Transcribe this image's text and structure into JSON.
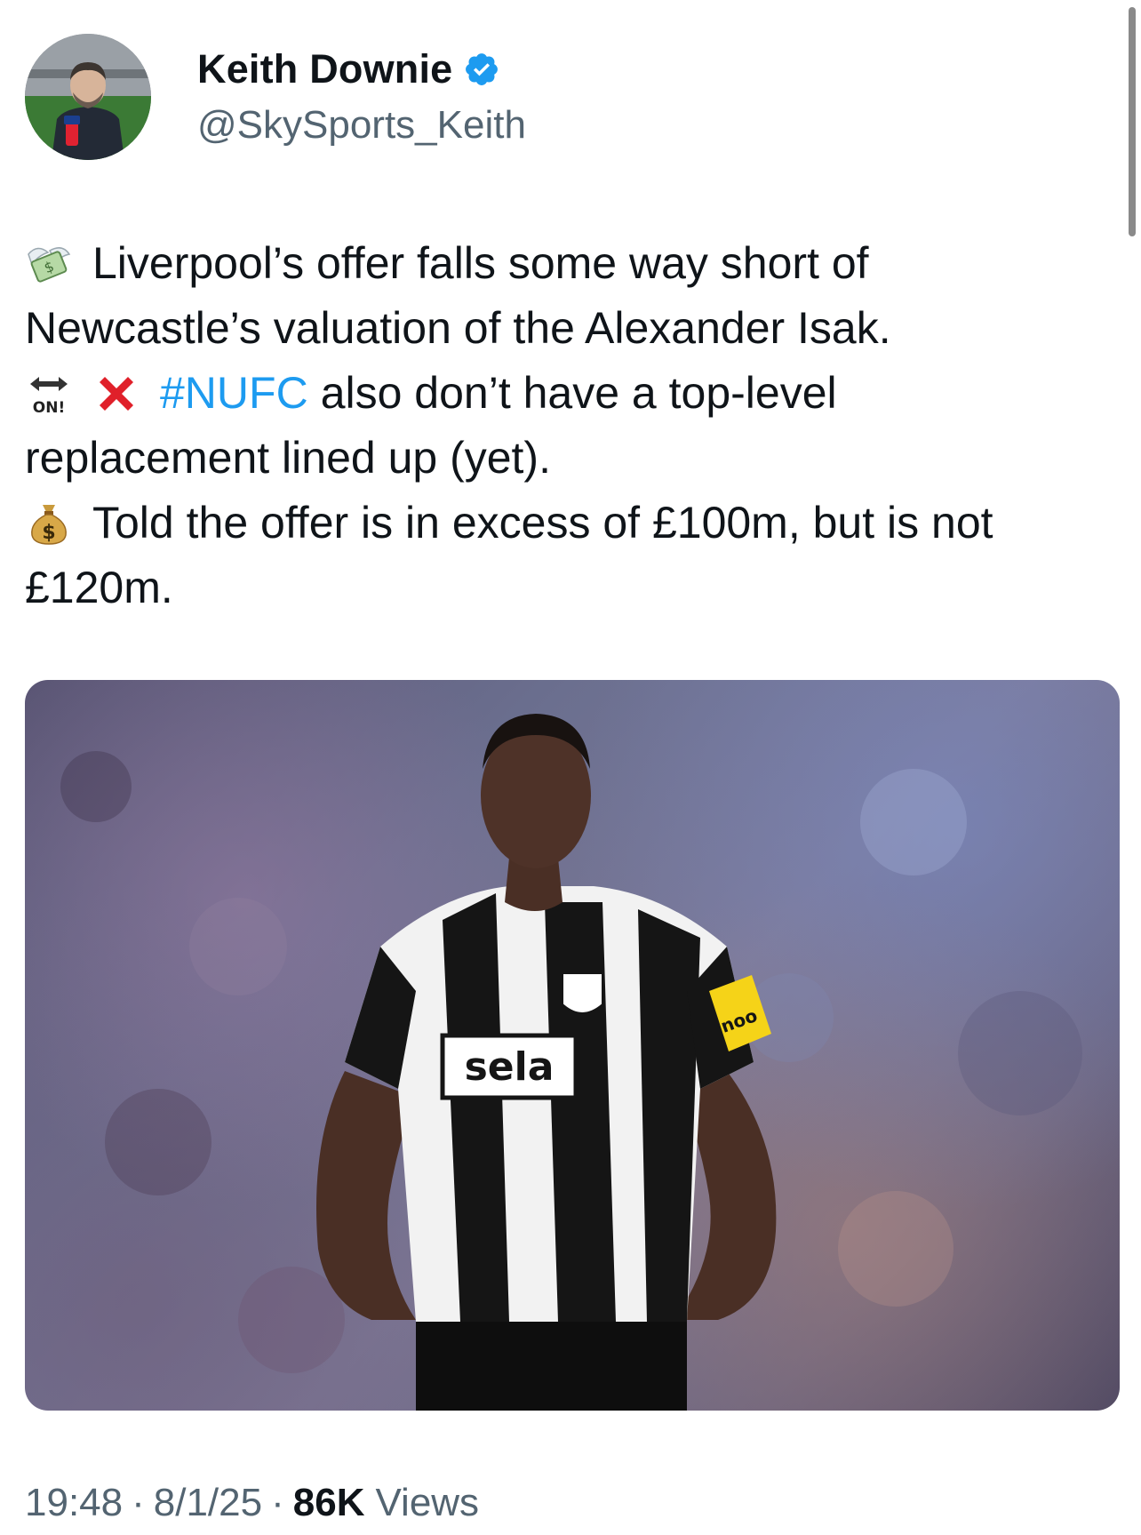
{
  "author": {
    "display_name": "Keith Downie",
    "handle": "@SkySports_Keith",
    "verified": true,
    "verified_color": "#1d9bf0"
  },
  "tweet": {
    "lines": [
      {
        "emoji": "money-with-wings",
        "text": "Liverpool’s offer falls some way short of"
      },
      {
        "text": "Newcastle’s valuation of the Alexander Isak."
      },
      {
        "emoji": "on-arrow",
        "emoji_label": "ON!",
        "emoji2": "cross-mark",
        "hashtag": "#NUFC",
        "text": "also don’t have a top-level"
      },
      {
        "text": "replacement lined up (yet)."
      },
      {
        "emoji": "money-bag",
        "text": "Told the offer is in excess of £100m, but is not"
      },
      {
        "text": "£120m."
      }
    ]
  },
  "media": {
    "shirt_sponsor": "sela",
    "armband_text": "noo"
  },
  "meta": {
    "time": "19:48",
    "separator": "·",
    "date": "8/1/25",
    "views_count": "86K",
    "views_label": "Views"
  },
  "colors": {
    "link": "#1d9bf0",
    "text": "#0f1419",
    "secondary": "#536471"
  }
}
